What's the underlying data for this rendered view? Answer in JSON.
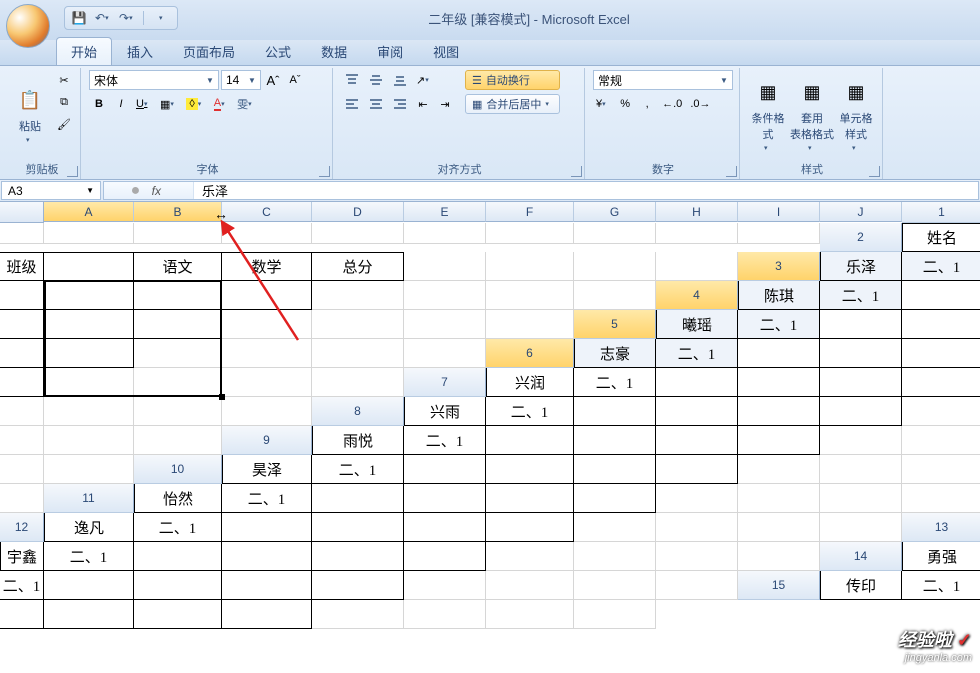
{
  "title": "二年级  [兼容模式] - Microsoft Excel",
  "tabs": [
    "开始",
    "插入",
    "页面布局",
    "公式",
    "数据",
    "审阅",
    "视图"
  ],
  "activeTab": 0,
  "ribbon": {
    "clipboard": {
      "label": "剪贴板",
      "paste": "粘贴"
    },
    "font": {
      "label": "字体",
      "family": "宋体",
      "size": "14",
      "bold": "B",
      "italic": "I",
      "underline": "U",
      "bigA": "A",
      "smallA": "A",
      "wen": "雯"
    },
    "align": {
      "label": "对齐方式",
      "wrap": "自动换行",
      "merge": "合并后居中"
    },
    "number": {
      "label": "数字",
      "format": "常规",
      "percent": "%",
      "comma": ",",
      "inc": ".0",
      "dec": ".00"
    },
    "styles": {
      "label": "样式",
      "cond": "条件格式",
      "table": "套用\n表格格式",
      "cell": "单元格\n样式"
    }
  },
  "nameBox": "A3",
  "formula": "乐泽",
  "columns": [
    "A",
    "B",
    "C",
    "D",
    "E",
    "F",
    "G",
    "H",
    "I",
    "J"
  ],
  "selectedCols": [
    0,
    1
  ],
  "selectedRows": [
    3,
    4,
    5,
    6
  ],
  "data": {
    "headerRow": [
      "姓名",
      "班级",
      "",
      "语文",
      "数学",
      "总分"
    ],
    "rows": [
      [
        "乐泽",
        "二、1",
        "",
        "",
        "",
        ""
      ],
      [
        "陈琪",
        "二、1",
        "",
        "",
        "",
        ""
      ],
      [
        "曦瑶",
        "二、1",
        "",
        "",
        "",
        ""
      ],
      [
        "志豪",
        "二、1",
        "",
        "",
        "",
        ""
      ],
      [
        "兴润",
        "二、1",
        "",
        "",
        "",
        ""
      ],
      [
        "兴雨",
        "二、1",
        "",
        "",
        "",
        ""
      ],
      [
        "雨悦",
        "二、1",
        "",
        "",
        "",
        ""
      ],
      [
        "昊泽",
        "二、1",
        "",
        "",
        "",
        ""
      ],
      [
        "怡然",
        "二、1",
        "",
        "",
        "",
        ""
      ],
      [
        "逸凡",
        "二、1",
        "",
        "",
        "",
        ""
      ],
      [
        "宇鑫",
        "二、1",
        "",
        "",
        "",
        ""
      ],
      [
        "勇强",
        "二、1",
        "",
        "",
        "",
        ""
      ],
      [
        "传印",
        "二、1",
        "",
        "",
        "",
        ""
      ]
    ]
  },
  "watermark": {
    "line1": "经验啦",
    "check": "✓",
    "line2": "jingyanla.com"
  }
}
